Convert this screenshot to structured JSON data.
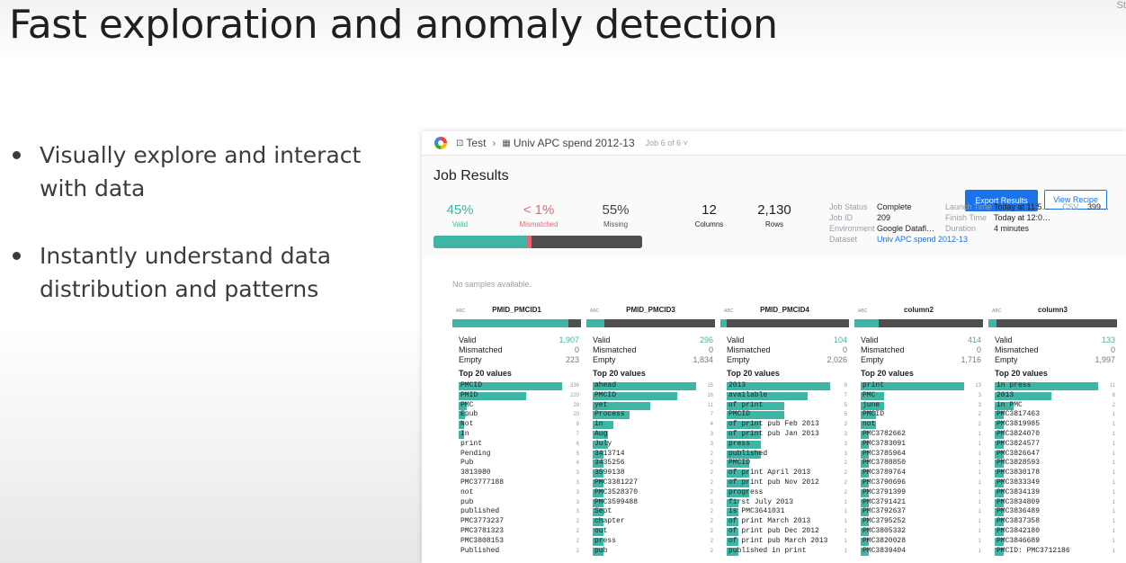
{
  "slide": {
    "title": "Fast exploration and anomaly detection",
    "corner_text": "St",
    "bullets": [
      "Visually explore and interact with data",
      "Instantly understand data distribution and patterns"
    ]
  },
  "app": {
    "breadcrumb": {
      "project": "Test",
      "dataset": "Univ APC spend 2012-13",
      "job_of": "Job 6 of 6"
    },
    "title": "Job Results",
    "buttons": {
      "export": "Export Results",
      "recipe": "View Recipe"
    },
    "colors": {
      "valid": "#3fb5a5",
      "mismatched": "#e06a78",
      "missing": "#4f4f4f",
      "accent": "#1a73e8"
    },
    "summary": {
      "valid_pct": "45%",
      "valid_label": "Valid",
      "mismatched_pct": "< 1%",
      "mismatched_label": "Mismatched",
      "missing_pct": "55%",
      "missing_label": "Missing",
      "columns_value": "12",
      "columns_label": "Columns",
      "rows_value": "2,130",
      "rows_label": "Rows",
      "bar": {
        "valid": 0.45,
        "mismatched": 0.02
      }
    },
    "meta": {
      "job_status_key": "Job Status",
      "job_status": "Complete",
      "job_id_key": "Job ID",
      "job_id": "209",
      "environment_key": "Environment",
      "environment": "Google Datafl…",
      "dataset_key": "Dataset",
      "dataset": "Univ APC spend 2012-13",
      "launch_key": "Launch Time",
      "launch": "Today at 11:5…",
      "finish_key": "Finish Time",
      "finish": "Today at 12:0…",
      "duration_key": "Duration",
      "duration": "4 minutes",
      "csv_key": "CSV",
      "csv": "399…"
    },
    "no_samples": "No samples available.",
    "labels": {
      "valid": "Valid",
      "mismatched": "Mismatched",
      "empty": "Empty",
      "top20": "Top 20 values",
      "type": "ABC"
    },
    "columns": [
      {
        "name": "PMID_PMCID1",
        "valid_frac": 0.9,
        "valid": "1,907",
        "mismatched": "0",
        "empty": "223",
        "values": [
          [
            "PMCID",
            "336",
            1
          ],
          [
            "PMID",
            "220",
            0.65
          ],
          [
            "PMC",
            "28",
            0.08
          ],
          [
            "Epub",
            "20",
            0.06
          ],
          [
            "Not",
            "8",
            0.02
          ],
          [
            "In",
            "7",
            0.02
          ],
          [
            "print",
            "6",
            0
          ],
          [
            "Pending",
            "5",
            0
          ],
          [
            "Pub",
            "4",
            0
          ],
          [
            "3813980",
            "3",
            0
          ],
          [
            "PMC3777188",
            "3",
            0
          ],
          [
            "not",
            "3",
            0
          ],
          [
            "pub",
            "3",
            0
          ],
          [
            "published",
            "3",
            0
          ],
          [
            "PMC3773237",
            "2",
            0
          ],
          [
            "PMC3781323",
            "2",
            0
          ],
          [
            "PMC3808153",
            "2",
            0
          ],
          [
            "Published",
            "2",
            0
          ]
        ]
      },
      {
        "name": "PMID_PMCID3",
        "valid_frac": 0.14,
        "valid": "296",
        "mismatched": "0",
        "empty": "1,834",
        "values": [
          [
            "ahead",
            "15",
            1
          ],
          [
            "PMCID",
            "16",
            0.82
          ],
          [
            "yet",
            "11",
            0.56
          ],
          [
            "Process",
            "7",
            0.36
          ],
          [
            "in",
            "4",
            0.2
          ],
          [
            "Aug",
            "3",
            0.15
          ],
          [
            "July",
            "3",
            0.15
          ],
          [
            "3413714",
            "2",
            0.1
          ],
          [
            "3435256",
            "2",
            0.1
          ],
          [
            "3599138",
            "2",
            0.1
          ],
          [
            "PMC3381227",
            "2",
            0.1
          ],
          [
            "PMC3528370",
            "2",
            0.1
          ],
          [
            "PMC3599488",
            "2",
            0.1
          ],
          [
            "Sept",
            "2",
            0.1
          ],
          [
            "chapter",
            "2",
            0.1
          ],
          [
            "out",
            "2",
            0.1
          ],
          [
            "press",
            "2",
            0.1
          ],
          [
            "pub",
            "2",
            0.1
          ]
        ]
      },
      {
        "name": "PMID_PMCID4",
        "valid_frac": 0.05,
        "valid": "104",
        "mismatched": "0",
        "empty": "2,026",
        "values": [
          [
            "2013",
            "9",
            1
          ],
          [
            "available",
            "7",
            0.78
          ],
          [
            "of print",
            "5",
            0.56
          ],
          [
            "PMCID",
            "5",
            0.56
          ],
          [
            "of print pub Feb 2013",
            "3",
            0.33
          ],
          [
            "of print pub Jan 2013",
            "3",
            0.33
          ],
          [
            "press",
            "3",
            0.33
          ],
          [
            "published",
            "3",
            0.33
          ],
          [
            "PMCID",
            "2",
            0.22
          ],
          [
            "of print April 2013",
            "2",
            0.22
          ],
          [
            "of print pub Nov 2012",
            "2",
            0.22
          ],
          [
            "progress",
            "2",
            0.22
          ],
          [
            "first July 2013",
            "1",
            0.11
          ],
          [
            "is PMC3641031",
            "1",
            0.11
          ],
          [
            "of print March 2013",
            "1",
            0.11
          ],
          [
            "of print pub Dec 2012",
            "1",
            0.11
          ],
          [
            "of print pub March 2013",
            "1",
            0.11
          ],
          [
            "published in print",
            "1",
            0.11
          ]
        ]
      },
      {
        "name": "column2",
        "valid_frac": 0.19,
        "valid": "414",
        "mismatched": "0",
        "empty": "1,716",
        "values": [
          [
            "print",
            "13",
            1
          ],
          [
            "PMC",
            "3",
            0.23
          ],
          [
            "june",
            "3",
            0.23
          ],
          [
            "PMCID",
            "2",
            0.15
          ],
          [
            "not",
            "2",
            0.15
          ],
          [
            "PMC3782662",
            "1",
            0.08
          ],
          [
            "PMC3783091",
            "1",
            0.08
          ],
          [
            "PMC3785964",
            "1",
            0.08
          ],
          [
            "PMC3788850",
            "1",
            0.08
          ],
          [
            "PMC3789764",
            "1",
            0.08
          ],
          [
            "PMC3790696",
            "1",
            0.08
          ],
          [
            "PMC3791399",
            "1",
            0.08
          ],
          [
            "PMC3791421",
            "1",
            0.08
          ],
          [
            "PMC3792637",
            "1",
            0.08
          ],
          [
            "PMC3795252",
            "1",
            0.08
          ],
          [
            "PMC3805332",
            "1",
            0.08
          ],
          [
            "PMC3820028",
            "1",
            0.08
          ],
          [
            "PMC3839404",
            "1",
            0.08
          ]
        ]
      },
      {
        "name": "column3",
        "valid_frac": 0.06,
        "valid": "133",
        "mismatched": "0",
        "empty": "1,997",
        "values": [
          [
            "in press",
            "11",
            1
          ],
          [
            "2013",
            "6",
            0.55
          ],
          [
            "in PMC",
            "2",
            0.18
          ],
          [
            "PMC3817463",
            "1",
            0.09
          ],
          [
            "PMC3819985",
            "1",
            0.09
          ],
          [
            "PMC3824070",
            "1",
            0.09
          ],
          [
            "PMC3824577",
            "1",
            0.09
          ],
          [
            "PMC3826647",
            "1",
            0.09
          ],
          [
            "PMC3828593",
            "1",
            0.09
          ],
          [
            "PMC3830178",
            "1",
            0.09
          ],
          [
            "PMC3833349",
            "1",
            0.09
          ],
          [
            "PMC3834139",
            "1",
            0.09
          ],
          [
            "PMC3834809",
            "1",
            0.09
          ],
          [
            "PMC3836489",
            "1",
            0.09
          ],
          [
            "PMC3837358",
            "1",
            0.09
          ],
          [
            "PMC3842180",
            "1",
            0.09
          ],
          [
            "PMC3846689",
            "1",
            0.09
          ],
          [
            "PMCID: PMC3712186",
            "1",
            0.09
          ]
        ]
      }
    ]
  }
}
